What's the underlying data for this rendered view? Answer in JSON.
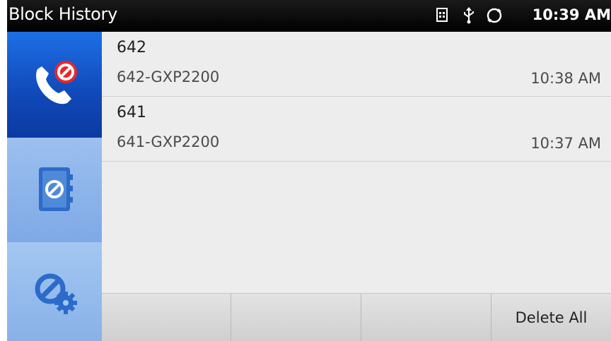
{
  "statusbar": {
    "title": "Block History",
    "clock": "10:39 AM",
    "icons": [
      "sim-card-icon",
      "usb-icon",
      "sync-icon"
    ]
  },
  "nav": {
    "items": [
      {
        "icon": "blocked-call-icon",
        "active": true
      },
      {
        "icon": "blocked-contacts-icon",
        "active": false
      },
      {
        "icon": "block-settings-icon",
        "active": false
      }
    ]
  },
  "history": [
    {
      "number": "642",
      "name": "642-GXP2200",
      "time": "10:38 AM"
    },
    {
      "number": "641",
      "name": "641-GXP2200",
      "time": "10:37 AM"
    }
  ],
  "toolbar": {
    "buttons": [
      "",
      "",
      "",
      "Delete All"
    ]
  },
  "colors": {
    "nav_active": "#1048b8",
    "nav_inactive": "#88b1e8",
    "block_red": "#e8262b",
    "content_bg": "#ededed",
    "statusbar_bg": "#000000"
  }
}
